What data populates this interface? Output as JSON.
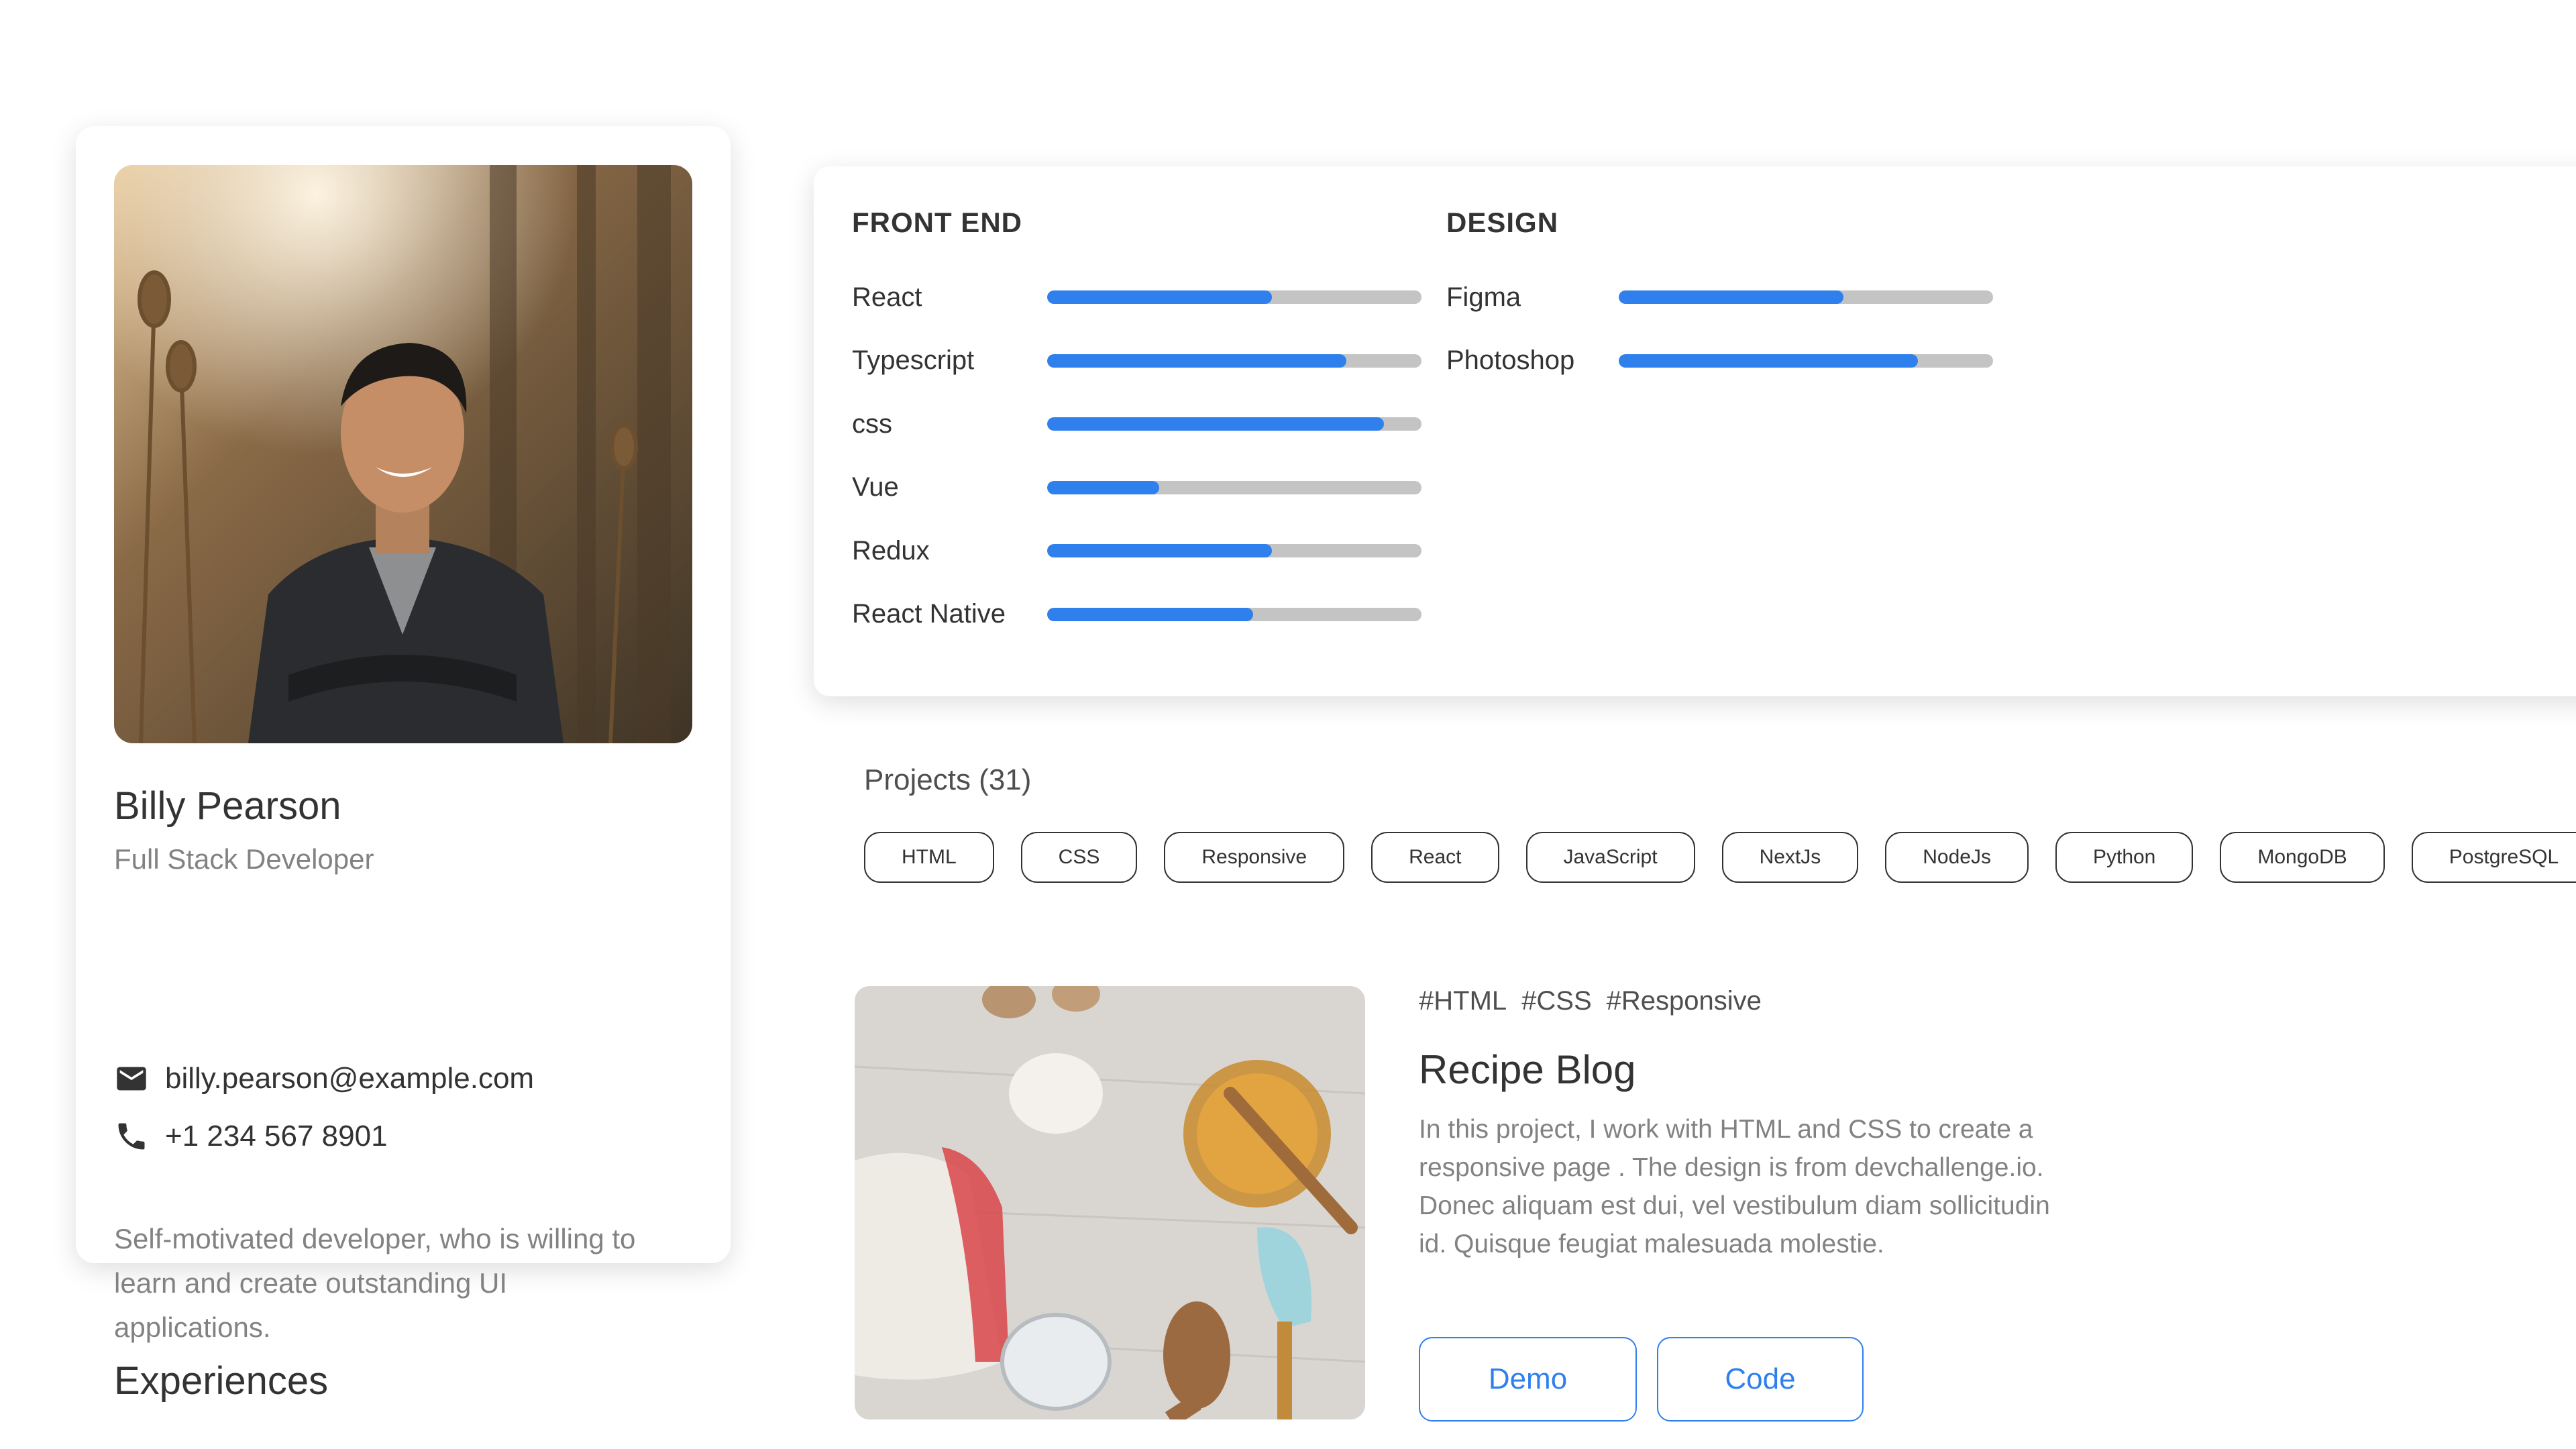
{
  "profile": {
    "name": "Billy Pearson",
    "role": "Full Stack Developer",
    "email": "billy.pearson@example.com",
    "phone": "+1 234 567 8901",
    "bio": "Self-motivated developer, who is willing to learn and create outstanding UI applications."
  },
  "skills": {
    "frontend": {
      "title": "FRONT END",
      "items": [
        {
          "label": "React",
          "level": 0.6
        },
        {
          "label": "Typescript",
          "level": 0.8
        },
        {
          "label": "css",
          "level": 0.9
        },
        {
          "label": "Vue",
          "level": 0.3
        },
        {
          "label": "Redux",
          "level": 0.6
        },
        {
          "label": "React Native",
          "level": 0.55
        }
      ]
    },
    "design": {
      "title": "DESIGN",
      "items": [
        {
          "label": "Figma",
          "level": 0.6
        },
        {
          "label": "Photoshop",
          "level": 0.8
        }
      ]
    },
    "bar_color": "#2F80ED",
    "track_color": "#C4C4C4"
  },
  "projects": {
    "title": "Projects (31)",
    "filters": [
      "HTML",
      "CSS",
      "Responsive",
      "React",
      "JavaScript",
      "NextJs",
      "NodeJs",
      "Python",
      "MongoDB",
      "PostgreSQL"
    ],
    "featured": {
      "hashtags": [
        "#HTML",
        "#CSS",
        "#Responsive"
      ],
      "title": "Recipe Blog",
      "description": "In this project, I work with HTML and CSS to create a responsive page . The design is from devchallenge.io. Donec aliquam est dui, vel vestibulum diam sollicitudin id. Quisque feugiat malesuada molestie.",
      "demo_label": "Demo",
      "code_label": "Code"
    }
  },
  "experiences": {
    "title": "Experiences"
  },
  "icons": {
    "email": "mail-icon",
    "phone": "phone-icon"
  },
  "colors": {
    "accent": "#2F80ED",
    "text_primary": "#333333",
    "text_secondary": "#828282"
  }
}
